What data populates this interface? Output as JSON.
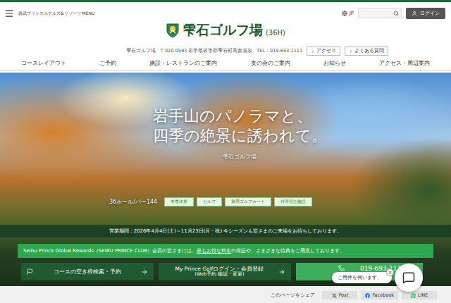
{
  "header": {
    "brand_menu": "西武プリンスホテルズ&リゾーツ MENU",
    "language": "JP",
    "login": "ログイン"
  },
  "logo": {
    "name": "雫石ゴルフ場",
    "suffix": "(36H)"
  },
  "info": {
    "name": "雫石ゴルフ場",
    "address": "〒020-0593 岩手県岩手郡雫石町高倉温泉",
    "tel": "TEL：019-693-1111",
    "links": [
      "アクセス",
      "よくある質問"
    ]
  },
  "nav": [
    "コースレイアウト",
    "ご予約",
    "施設・レストランのご案内",
    "友の会のご案内",
    "お知らせ",
    "アクセス・周辺案内"
  ],
  "hero": {
    "headline": [
      "岩手山のパノラマと、",
      "四季の絶景に誘われて。"
    ],
    "subtitle": "雫石ゴルフ場",
    "spec": "36ホール/パー144",
    "tags": [
      "冬季休業",
      "セルフ",
      "乗用ゴルフカート",
      "付帯宿泊施設"
    ]
  },
  "notice": "営業期間：2026年4月4日(土)～11月23日(月・祝) 今シーズンも皆さまのご来場をお待ちしております。",
  "rewards": {
    "before": "Seibu Prince Global Rewards（SEIBU PRINCE CLUB）会員の皆さまには、",
    "link": "最もお得な料金",
    "after": "の保証や、さまざまな特典をご用意しております。"
  },
  "actions": [
    {
      "kind": "reserve",
      "label": "コースの空き枠検索・予約",
      "sub": ""
    },
    {
      "kind": "member",
      "label": "My Prince Golfログイン・会員登録",
      "sub": "(Web予約 確認・変更)"
    },
    {
      "kind": "phone",
      "label": "019-693-1111",
      "sub": ""
    }
  ],
  "chat": {
    "message": "ご用件を伺います。",
    "close": "×"
  },
  "share": {
    "label": "このページをシェア",
    "buttons": [
      {
        "kind": "x",
        "label": "Post"
      },
      {
        "kind": "facebook",
        "label": "Facebook"
      },
      {
        "kind": "line",
        "label": "LINE"
      }
    ]
  }
}
